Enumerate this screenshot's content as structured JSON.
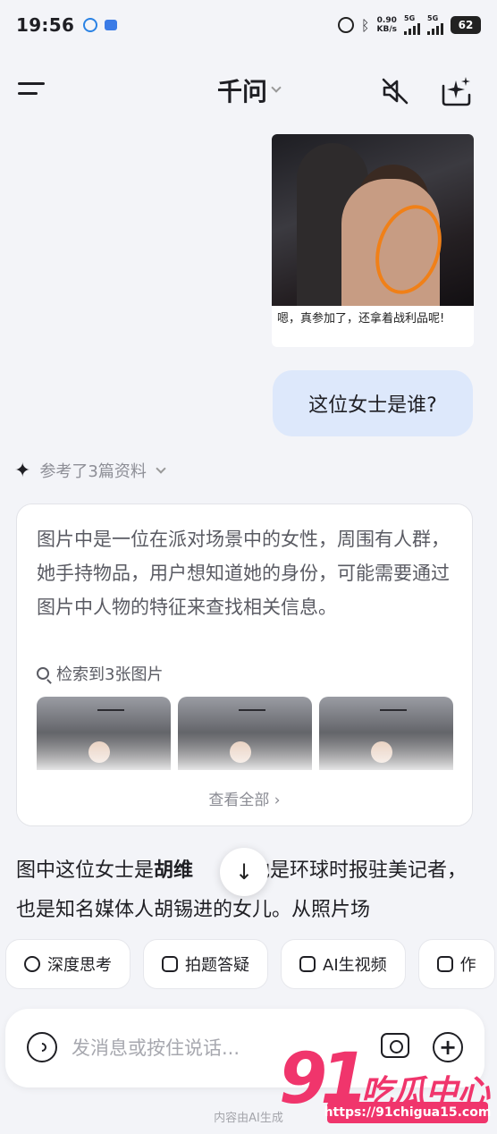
{
  "status_bar": {
    "time": "19:56",
    "net_speed_value": "0.90",
    "net_speed_unit": "KB/s",
    "sim1": "5G",
    "sim2": "5G",
    "battery": "62"
  },
  "header": {
    "title": "千问",
    "menu_icon": "menu-icon",
    "mute_icon": "speaker-muted-icon",
    "new_chat_icon": "new-chat-sparkle-icon"
  },
  "shared_image": {
    "caption": "嗯，真参加了，还拿着战利品呢!"
  },
  "user_message": {
    "text": "这位女士是谁?"
  },
  "references": {
    "label": "参考了3篇资料"
  },
  "thinking": {
    "text": "图片中是一位在派对场景中的女性，周围有人群，她手持物品，用户想知道她的身份，可能需要通过图片中人物的特征来查找相关信息。",
    "search_label": "检索到3张图片",
    "view_all": "查看全部 ›"
  },
  "answer": {
    "prefix": "图中这位女士是",
    "name": "胡维",
    "rest": "她是环球时报驻美记者，也是知名媒体人胡锡进的女儿。从照片场"
  },
  "chips": [
    {
      "label": "深度思考",
      "icon": "deep-think-icon"
    },
    {
      "label": "拍题答疑",
      "icon": "camera-question-icon"
    },
    {
      "label": "AI生视频",
      "icon": "ai-video-icon"
    },
    {
      "label": "作",
      "icon": "document-icon"
    }
  ],
  "input": {
    "placeholder": "发消息或按住说话..."
  },
  "footer": {
    "note": "内容由AI生成"
  },
  "watermark": {
    "number": "91",
    "brand": "吃瓜中心",
    "url": "https://91chigua15.com"
  }
}
